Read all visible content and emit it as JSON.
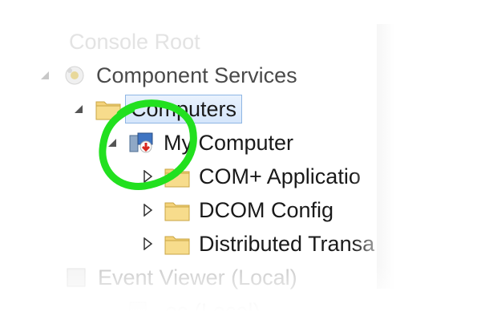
{
  "tree": {
    "root": {
      "label": "Console Root",
      "icon": "console-root-icon"
    },
    "items": [
      {
        "label": "Component Services",
        "icon": "component-services-icon",
        "expander": "expanded"
      },
      {
        "label": "Computers",
        "icon": "folder-icon",
        "expander": "expanded",
        "selected": true
      },
      {
        "label": "My Computer",
        "icon": "my-computer-icon",
        "expander": "expanded"
      },
      {
        "label": "COM+ Applicatio",
        "icon": "folder-icon",
        "expander": "collapsed"
      },
      {
        "label": "DCOM Config",
        "icon": "folder-icon",
        "expander": "collapsed"
      },
      {
        "label": "Distributed Transa",
        "icon": "folder-icon",
        "expander": "collapsed"
      },
      {
        "label": "Event Viewer (Local)",
        "icon": "event-viewer-icon"
      },
      {
        "label": "es (Local)",
        "icon": "services-icon"
      }
    ]
  },
  "colors": {
    "highlight": "#22e01f",
    "selection_border": "#8fb6e4",
    "folder": "#f4d27a"
  }
}
